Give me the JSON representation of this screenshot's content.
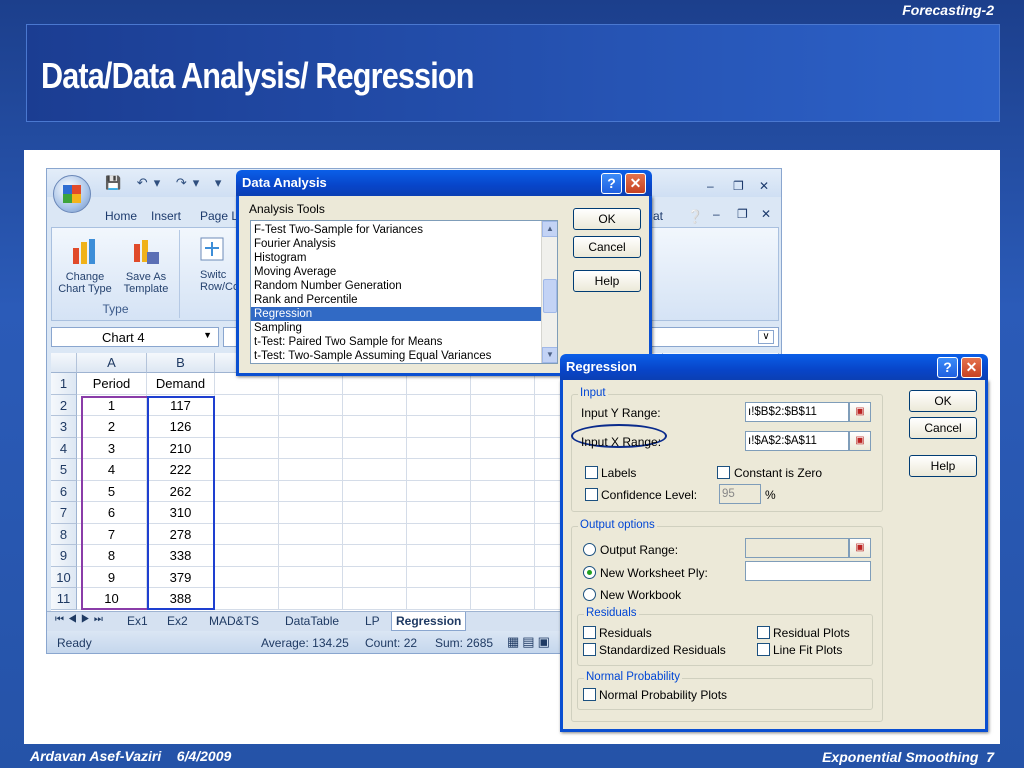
{
  "slide": {
    "corner_label": "Forecasting-2",
    "title": "Data/Data Analysis/ Regression",
    "footer_left": "Ardavan Asef-Vaziri    6/4/2009",
    "footer_right": "Exponential Smoothing  7"
  },
  "excel": {
    "tabs": [
      "Home",
      "Insert",
      "Page L"
    ],
    "tab_right": "at",
    "ribbon": {
      "change_chart_type": "Change Chart Type",
      "save_as_template": "Save As Template",
      "switch_row_col": "Switc Row/Col",
      "group_label": "Type"
    },
    "name_box": "Chart 4",
    "columns": [
      "A",
      "B"
    ],
    "rows": [
      "1",
      "2",
      "3",
      "4",
      "5",
      "6",
      "7",
      "8",
      "9",
      "10",
      "11"
    ],
    "table": {
      "headers": [
        "Period",
        "Demand"
      ],
      "periods": [
        "1",
        "2",
        "3",
        "4",
        "5",
        "6",
        "7",
        "8",
        "9",
        "10"
      ],
      "demand": [
        "117",
        "126",
        "210",
        "222",
        "262",
        "310",
        "278",
        "338",
        "379",
        "388"
      ]
    },
    "sheet_tabs": [
      "Ex1",
      "Ex2",
      "MAD&TS",
      "DataTable",
      "LP",
      "Regression"
    ],
    "active_sheet": "Regression",
    "status": {
      "ready": "Ready",
      "average": "Average: 134.25",
      "count": "Count: 22",
      "sum": "Sum: 2685"
    }
  },
  "data_analysis": {
    "title": "Data Analysis",
    "tools_label": "Analysis Tools",
    "tools": [
      "F-Test Two-Sample for Variances",
      "Fourier Analysis",
      "Histogram",
      "Moving Average",
      "Random Number Generation",
      "Rank and Percentile",
      "Regression",
      "Sampling",
      "t-Test: Paired Two Sample for Means",
      "t-Test: Two-Sample Assuming Equal Variances"
    ],
    "selected_tool": "Regression",
    "ok": "OK",
    "cancel": "Cancel",
    "help": "Help"
  },
  "regression": {
    "title": "Regression",
    "input_group": "Input",
    "input_y_label": "Input Y Range:",
    "input_y_value": "ı!$B$2:$B$11",
    "input_x_label": "Input X Range:",
    "input_x_value": "ı!$A$2:$A$11",
    "labels": "Labels",
    "constant_zero": "Constant is Zero",
    "confidence_level": "Confidence Level:",
    "confidence_value": "95",
    "percent": "%",
    "output_group": "Output options",
    "output_range": "Output Range:",
    "new_worksheet": "New Worksheet Ply:",
    "new_workbook": "New Workbook",
    "residuals_group": "Residuals",
    "residuals": "Residuals",
    "standardized_residuals": "Standardized Residuals",
    "residual_plots": "Residual Plots",
    "line_fit_plots": "Line Fit Plots",
    "normal_group": "Normal Probability",
    "normal_plots": "Normal Probability Plots",
    "ok": "OK",
    "cancel": "Cancel",
    "help": "Help"
  },
  "colors": {
    "slide_bg": "#2553a8",
    "xp_title": "#0a5fe8",
    "selection": "#316ac5",
    "highlight_oval": "#0a2b8c"
  }
}
